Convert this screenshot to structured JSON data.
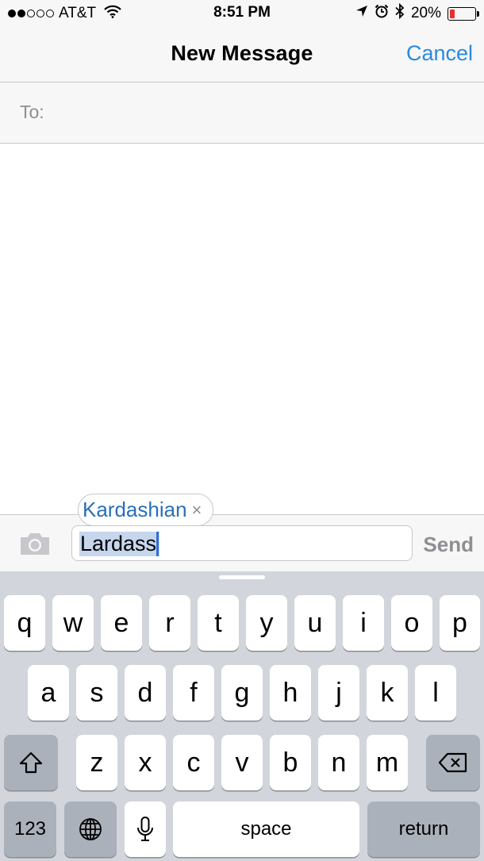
{
  "status_bar": {
    "carrier": "AT&T",
    "signal_strength": 2,
    "signal_total": 5,
    "time": "8:51 PM",
    "battery_percent": "20%",
    "battery_level": 0.2,
    "icons": [
      "wifi-icon",
      "location-arrow-icon",
      "alarm-icon",
      "bluetooth-icon",
      "battery-icon"
    ]
  },
  "nav": {
    "title": "New Message",
    "cancel_label": "Cancel",
    "accent_color": "#2a8adf"
  },
  "to_field": {
    "label": "To:"
  },
  "compose": {
    "input_value": "Lardass",
    "send_label": "Send",
    "autocorrect_suggestion": "Kardashian",
    "autocorrect_dismiss": "×",
    "camera_icon": "camera-icon"
  },
  "keyboard": {
    "row1": [
      "q",
      "w",
      "e",
      "r",
      "t",
      "y",
      "u",
      "i",
      "o",
      "p"
    ],
    "row2": [
      "a",
      "s",
      "d",
      "f",
      "g",
      "h",
      "j",
      "k",
      "l"
    ],
    "row3": [
      "z",
      "x",
      "c",
      "v",
      "b",
      "n",
      "m"
    ],
    "shift_icon": "shift-icon",
    "delete_icon": "delete-icon",
    "numbers_label": "123",
    "globe_icon": "globe-icon",
    "mic_icon": "microphone-icon",
    "space_label": "space",
    "return_label": "return"
  }
}
